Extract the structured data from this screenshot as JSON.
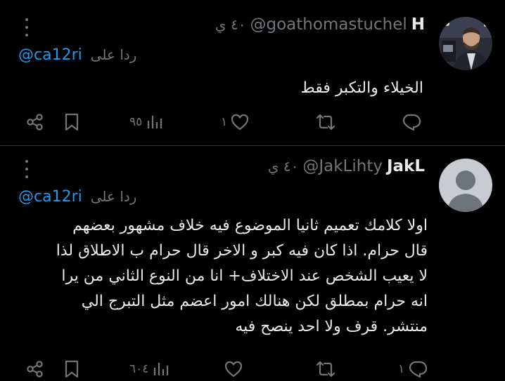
{
  "tweets": [
    {
      "display_name": "H",
      "handle": "@goathomastuchel",
      "time": "٤٠ ي",
      "reply_prefix": "ردا على",
      "reply_handle": "@ca12ri",
      "lines": [
        "الخيلاء والتكبر فقط"
      ],
      "stats": {
        "replies": "",
        "retweets": "",
        "likes": "١",
        "views": "٩٥"
      },
      "avatar_icon": "profile-photo"
    },
    {
      "display_name": "JakL",
      "handle": "@JakLihty",
      "time": "٤٠ ي",
      "reply_prefix": "ردا على",
      "reply_handle": "@ca12ri",
      "lines": [
        "اولا كلامك تعميم ثانيا  الموضوع فيه خلاف مشهور بعضهم",
        "قال حرام. اذا كان فيه كبر و الاخر قال حرام ب الاطلاق لذا",
        "لا يعيب الشخص عند الاختلاف+ انا من النوع الثاني من يرا",
        "انه حرام بمطلق لكن هنالك امور اعضم مثل التبرج الي",
        "منتشر. قرف ولا احد ينصح فيه"
      ],
      "stats": {
        "replies": "١",
        "retweets": "",
        "likes": "",
        "views": "٦٠٤"
      },
      "avatar_icon": "default-avatar"
    }
  ],
  "colors": {
    "background": "#000000",
    "text": "#e7e9ea",
    "muted": "#71767b",
    "link": "#1d9bf0",
    "divider": "#2f3336"
  }
}
